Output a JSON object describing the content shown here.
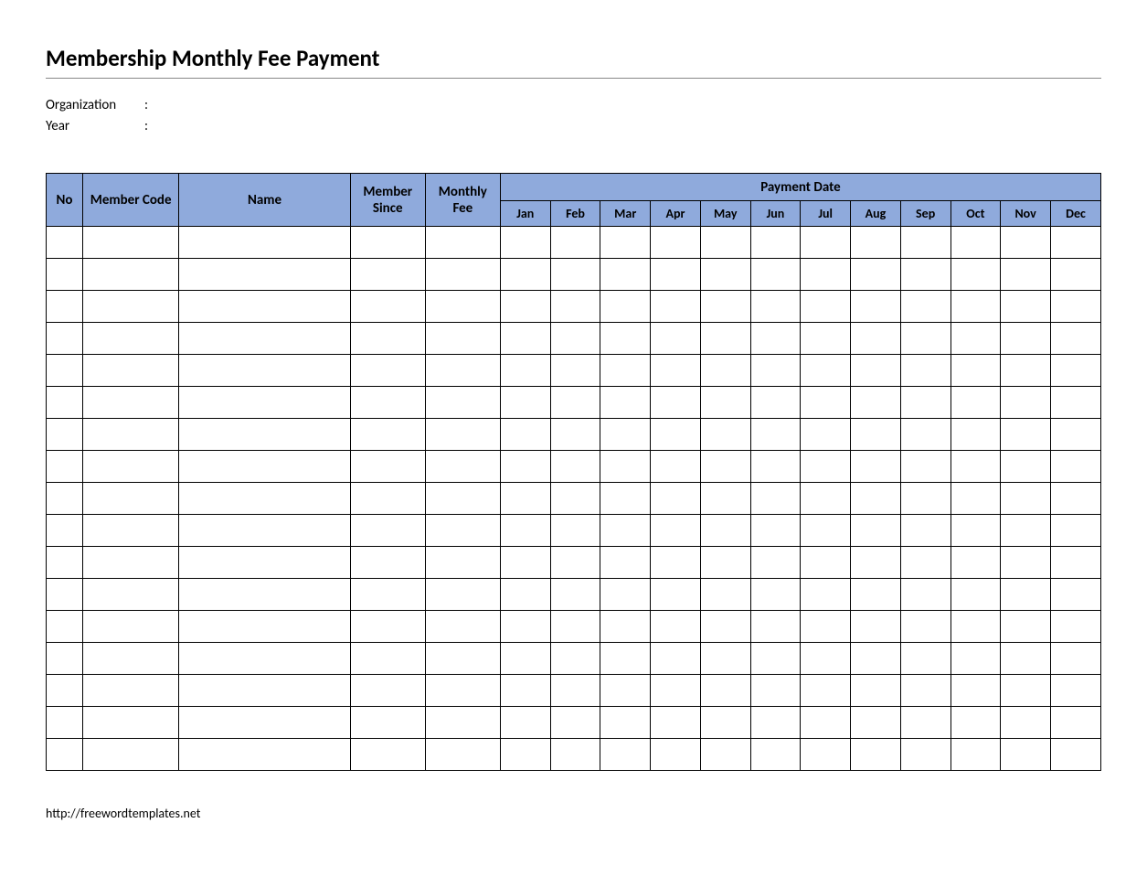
{
  "title": "Membership Monthly Fee Payment",
  "meta": {
    "organization_label": "Organization",
    "year_label": "Year",
    "colon": ":"
  },
  "headers": {
    "no": "No",
    "member_code": "Member Code",
    "name": "Name",
    "member_since": "Member Since",
    "monthly_fee": "Monthly Fee",
    "payment_date": "Payment Date",
    "months": [
      "Jan",
      "Feb",
      "Mar",
      "Apr",
      "May",
      "Jun",
      "Jul",
      "Aug",
      "Sep",
      "Oct",
      "Nov",
      "Dec"
    ]
  },
  "rows": [
    {
      "no": "",
      "code": "",
      "name": "",
      "since": "",
      "fee": "",
      "months": [
        "",
        "",
        "",
        "",
        "",
        "",
        "",
        "",
        "",
        "",
        "",
        ""
      ]
    },
    {
      "no": "",
      "code": "",
      "name": "",
      "since": "",
      "fee": "",
      "months": [
        "",
        "",
        "",
        "",
        "",
        "",
        "",
        "",
        "",
        "",
        "",
        ""
      ]
    },
    {
      "no": "",
      "code": "",
      "name": "",
      "since": "",
      "fee": "",
      "months": [
        "",
        "",
        "",
        "",
        "",
        "",
        "",
        "",
        "",
        "",
        "",
        ""
      ]
    },
    {
      "no": "",
      "code": "",
      "name": "",
      "since": "",
      "fee": "",
      "months": [
        "",
        "",
        "",
        "",
        "",
        "",
        "",
        "",
        "",
        "",
        "",
        ""
      ]
    },
    {
      "no": "",
      "code": "",
      "name": "",
      "since": "",
      "fee": "",
      "months": [
        "",
        "",
        "",
        "",
        "",
        "",
        "",
        "",
        "",
        "",
        "",
        ""
      ]
    },
    {
      "no": "",
      "code": "",
      "name": "",
      "since": "",
      "fee": "",
      "months": [
        "",
        "",
        "",
        "",
        "",
        "",
        "",
        "",
        "",
        "",
        "",
        ""
      ]
    },
    {
      "no": "",
      "code": "",
      "name": "",
      "since": "",
      "fee": "",
      "months": [
        "",
        "",
        "",
        "",
        "",
        "",
        "",
        "",
        "",
        "",
        "",
        ""
      ]
    },
    {
      "no": "",
      "code": "",
      "name": "",
      "since": "",
      "fee": "",
      "months": [
        "",
        "",
        "",
        "",
        "",
        "",
        "",
        "",
        "",
        "",
        "",
        ""
      ]
    },
    {
      "no": "",
      "code": "",
      "name": "",
      "since": "",
      "fee": "",
      "months": [
        "",
        "",
        "",
        "",
        "",
        "",
        "",
        "",
        "",
        "",
        "",
        ""
      ]
    },
    {
      "no": "",
      "code": "",
      "name": "",
      "since": "",
      "fee": "",
      "months": [
        "",
        "",
        "",
        "",
        "",
        "",
        "",
        "",
        "",
        "",
        "",
        ""
      ]
    },
    {
      "no": "",
      "code": "",
      "name": "",
      "since": "",
      "fee": "",
      "months": [
        "",
        "",
        "",
        "",
        "",
        "",
        "",
        "",
        "",
        "",
        "",
        ""
      ]
    },
    {
      "no": "",
      "code": "",
      "name": "",
      "since": "",
      "fee": "",
      "months": [
        "",
        "",
        "",
        "",
        "",
        "",
        "",
        "",
        "",
        "",
        "",
        ""
      ]
    },
    {
      "no": "",
      "code": "",
      "name": "",
      "since": "",
      "fee": "",
      "months": [
        "",
        "",
        "",
        "",
        "",
        "",
        "",
        "",
        "",
        "",
        "",
        ""
      ]
    },
    {
      "no": "",
      "code": "",
      "name": "",
      "since": "",
      "fee": "",
      "months": [
        "",
        "",
        "",
        "",
        "",
        "",
        "",
        "",
        "",
        "",
        "",
        ""
      ]
    },
    {
      "no": "",
      "code": "",
      "name": "",
      "since": "",
      "fee": "",
      "months": [
        "",
        "",
        "",
        "",
        "",
        "",
        "",
        "",
        "",
        "",
        "",
        ""
      ]
    },
    {
      "no": "",
      "code": "",
      "name": "",
      "since": "",
      "fee": "",
      "months": [
        "",
        "",
        "",
        "",
        "",
        "",
        "",
        "",
        "",
        "",
        "",
        ""
      ]
    },
    {
      "no": "",
      "code": "",
      "name": "",
      "since": "",
      "fee": "",
      "months": [
        "",
        "",
        "",
        "",
        "",
        "",
        "",
        "",
        "",
        "",
        "",
        ""
      ]
    }
  ],
  "footer": "http://freewordtemplates.net"
}
